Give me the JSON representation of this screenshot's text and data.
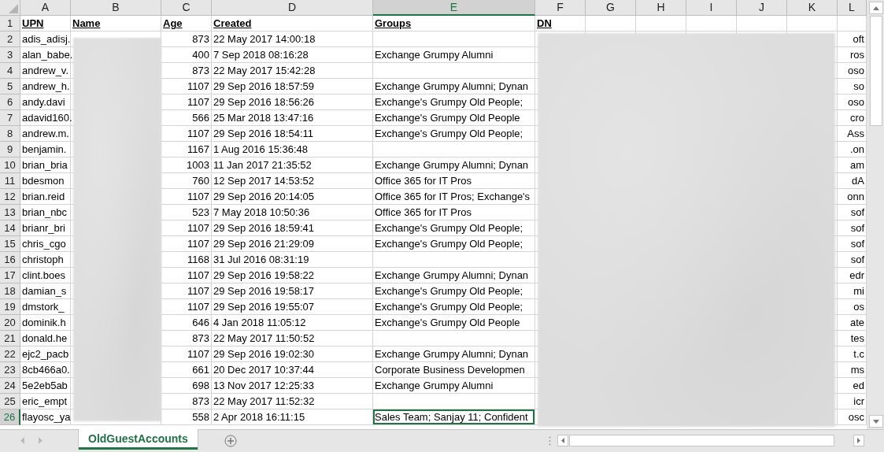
{
  "columns": [
    {
      "letter": "A",
      "selected": false
    },
    {
      "letter": "B",
      "selected": false
    },
    {
      "letter": "C",
      "selected": false
    },
    {
      "letter": "D",
      "selected": false
    },
    {
      "letter": "E",
      "selected": true
    },
    {
      "letter": "F",
      "selected": false
    },
    {
      "letter": "G",
      "selected": false
    },
    {
      "letter": "H",
      "selected": false
    },
    {
      "letter": "I",
      "selected": false
    },
    {
      "letter": "J",
      "selected": false
    },
    {
      "letter": "K",
      "selected": false
    },
    {
      "letter": "L",
      "selected": false
    }
  ],
  "header_row": {
    "number": "1",
    "cells": {
      "A": "UPN",
      "B": "Name",
      "C": "Age",
      "D": "Created",
      "E": "Groups",
      "F": "DN"
    }
  },
  "rows": [
    {
      "number": "2",
      "selected": false,
      "cells": {
        "A": "adis_adisj.",
        "C": "873",
        "D": "22 May 2017 14:00:18",
        "L": "oft"
      }
    },
    {
      "number": "3",
      "selected": false,
      "cells": {
        "A": "alan_babe.",
        "C": "400",
        "D": "7 Sep 2018 08:16:28",
        "E": "Exchange Grumpy Alumni",
        "L": "ros"
      }
    },
    {
      "number": "4",
      "selected": false,
      "cells": {
        "A": "andrew_v.",
        "C": "873",
        "D": "22 May 2017 15:42:28",
        "L": "oso"
      }
    },
    {
      "number": "5",
      "selected": false,
      "cells": {
        "A": "andrew_h.",
        "C": "1107",
        "D": "29 Sep 2016 18:57:59",
        "E": "Exchange Grumpy Alumni; Dynan",
        "L": "so"
      }
    },
    {
      "number": "6",
      "selected": false,
      "cells": {
        "A": "andy.davi",
        "C": "1107",
        "D": "29 Sep 2016 18:56:26",
        "E": "Exchange's Grumpy Old People;",
        "L": "oso"
      }
    },
    {
      "number": "7",
      "selected": false,
      "cells": {
        "A": "adavid160.",
        "C": "566",
        "D": "25 Mar 2018 13:47:16",
        "E": "Exchange's Grumpy Old People",
        "L": "cro"
      }
    },
    {
      "number": "8",
      "selected": false,
      "cells": {
        "A": "andrew.m.",
        "C": "1107",
        "D": "29 Sep 2016 18:54:11",
        "E": "Exchange's Grumpy Old People;",
        "L": "Ass"
      }
    },
    {
      "number": "9",
      "selected": false,
      "cells": {
        "A": "benjamin.",
        "C": "1167",
        "D": "1 Aug 2016 15:36:48",
        "L": ".on"
      }
    },
    {
      "number": "10",
      "selected": false,
      "cells": {
        "A": "brian_bria",
        "C": "1003",
        "D": "11 Jan 2017 21:35:52",
        "E": "Exchange Grumpy Alumni; Dynan",
        "L": "am"
      }
    },
    {
      "number": "11",
      "selected": false,
      "cells": {
        "A": "bdesmon",
        "C": "760",
        "D": "12 Sep 2017 14:53:52",
        "E": "Office 365 for IT Pros",
        "L": "dA"
      }
    },
    {
      "number": "12",
      "selected": false,
      "cells": {
        "A": "brian.reid",
        "C": "1107",
        "D": "29 Sep 2016 20:14:05",
        "E": "Office 365 for IT Pros; Exchange's",
        "L": "onn"
      }
    },
    {
      "number": "13",
      "selected": false,
      "cells": {
        "A": "brian_nbc",
        "C": "523",
        "D": "7 May 2018 10:50:36",
        "E": "Office 365 for IT Pros",
        "L": "sof"
      }
    },
    {
      "number": "14",
      "selected": false,
      "cells": {
        "A": "brianr_bri",
        "C": "1107",
        "D": "29 Sep 2016 18:59:41",
        "E": "Exchange's Grumpy Old People;",
        "L": "sof"
      }
    },
    {
      "number": "15",
      "selected": false,
      "cells": {
        "A": "chris_cgo",
        "C": "1107",
        "D": "29 Sep 2016 21:29:09",
        "E": "Exchange's Grumpy Old People;",
        "L": "sof"
      }
    },
    {
      "number": "16",
      "selected": false,
      "cells": {
        "A": "christoph",
        "C": "1168",
        "D": "31 Jul 2016 08:31:19",
        "L": "sof"
      }
    },
    {
      "number": "17",
      "selected": false,
      "cells": {
        "A": "clint.boes",
        "C": "1107",
        "D": "29 Sep 2016 19:58:22",
        "E": "Exchange Grumpy Alumni; Dynan",
        "L": "edr"
      }
    },
    {
      "number": "18",
      "selected": false,
      "cells": {
        "A": "damian_s",
        "C": "1107",
        "D": "29 Sep 2016 19:58:17",
        "E": "Exchange's Grumpy Old People;",
        "L": "mi"
      }
    },
    {
      "number": "19",
      "selected": false,
      "cells": {
        "A": "dmstork_",
        "C": "1107",
        "D": "29 Sep 2016 19:55:07",
        "E": "Exchange's Grumpy Old People;",
        "L": "os"
      }
    },
    {
      "number": "20",
      "selected": false,
      "cells": {
        "A": "dominik.h",
        "C": "646",
        "D": "4 Jan 2018 11:05:12",
        "E": "Exchange's Grumpy Old People",
        "L": "ate"
      }
    },
    {
      "number": "21",
      "selected": false,
      "cells": {
        "A": "donald.he",
        "C": "873",
        "D": "22 May 2017 11:50:52",
        "L": "tes"
      }
    },
    {
      "number": "22",
      "selected": false,
      "cells": {
        "A": "ejc2_pacb",
        "C": "1107",
        "D": "29 Sep 2016 19:02:30",
        "E": "Exchange Grumpy Alumni; Dynan",
        "L": "t.c"
      }
    },
    {
      "number": "23",
      "selected": false,
      "cells": {
        "A": "8cb466a0.",
        "C": "661",
        "D": "20 Dec 2017 10:37:44",
        "E": "Corporate Business Developmen",
        "L": "ms"
      }
    },
    {
      "number": "24",
      "selected": false,
      "cells": {
        "A": "5e2eb5ab",
        "C": "698",
        "D": "13 Nov 2017 12:25:33",
        "E": "Exchange Grumpy Alumni",
        "L": "ed"
      }
    },
    {
      "number": "25",
      "selected": false,
      "cells": {
        "A": "eric_empt",
        "C": "873",
        "D": "22 May 2017 11:52:32",
        "L": "icr"
      }
    },
    {
      "number": "26",
      "selected": true,
      "cells": {
        "A": "flayosc_ya",
        "C": "558",
        "D": "2 Apr 2018 16:11:15",
        "E": "Sales Team; Sanjay 11; Confident",
        "L": "osc"
      }
    }
  ],
  "sheet_tabs": [
    {
      "label": "OldGuestAccounts",
      "selected": true
    }
  ]
}
